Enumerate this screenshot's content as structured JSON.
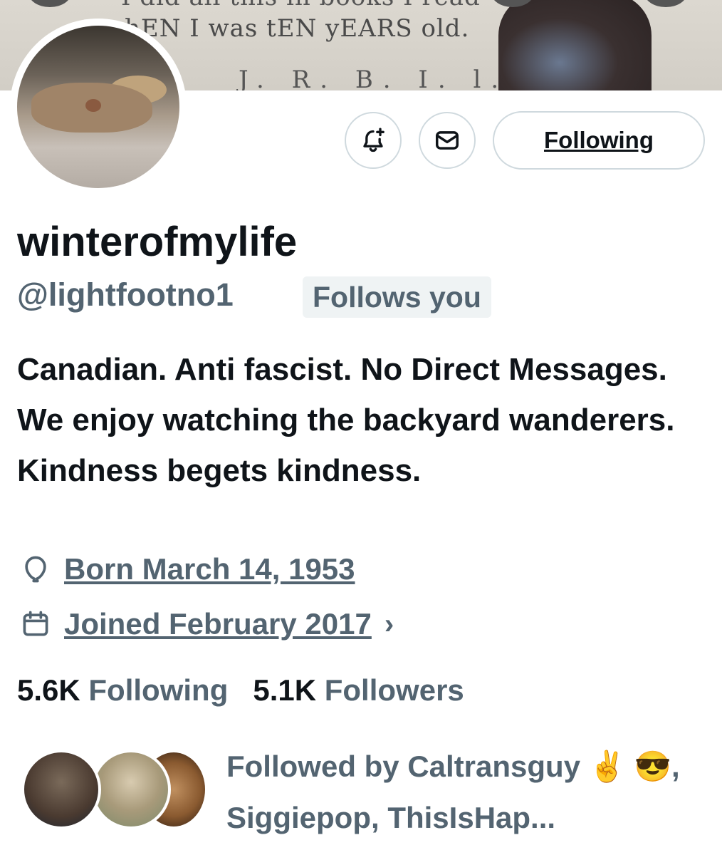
{
  "profile": {
    "display_name": "winterofmylife",
    "handle": "@lightfootno1",
    "follows_you_badge": "Follows you",
    "bio": "Canadian. Anti fascist. No Direct Messages. We enjoy watching the backyard wanderers. Kindness begets kindness.",
    "born": "Born March 14, 1953",
    "joined": "Joined February 2017",
    "following_count": "5.6K",
    "following_label": "Following",
    "followers_count": "5.1K",
    "followers_label": "Followers",
    "followed_by": "Followed by Caltransguy ✌️ 😎, Siggiepop, ThisIsHap..."
  },
  "banner": {
    "handwriting_line_top": "I did all this in books I read",
    "handwriting_line_main": "hEN I was tEN yEARS old.",
    "handwriting_line_bottom": "J. R. B. I. l."
  },
  "actions": {
    "notify_icon": "bell-plus-icon",
    "message_icon": "envelope-icon",
    "follow_button_label": "Following"
  },
  "meta_icons": {
    "born": "balloon-icon",
    "joined": "calendar-icon",
    "joined_chevron": "chevron-right-icon"
  },
  "colors": {
    "primary_text": "#0f1419",
    "secondary_text": "#536471",
    "border": "#cfd9de",
    "badge_bg": "#eff3f4"
  }
}
